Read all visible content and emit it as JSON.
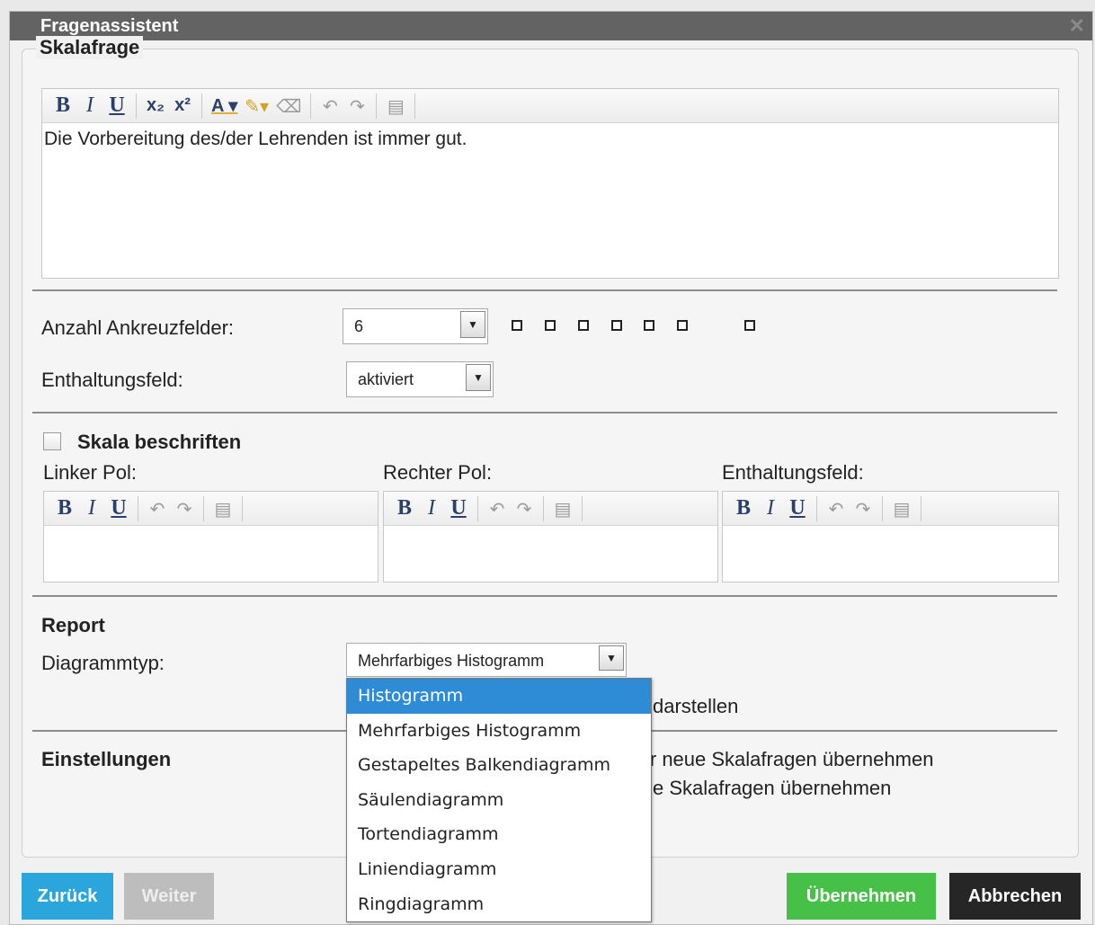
{
  "window": {
    "title": "Fragenassistent",
    "close_icon": "close-icon"
  },
  "question": {
    "legend": "Skalafrage",
    "text": "Die Vorbereitung des/der Lehrenden ist immer gut."
  },
  "toolbar_main": [
    "B",
    "I",
    "U",
    "X₂",
    "X²",
    "A",
    "✎",
    "⚲",
    "⟲",
    "⟳",
    "📋"
  ],
  "fields": {
    "anzahl_label": "Anzahl Ankreuzfelder:",
    "anzahl_value": "6",
    "enthaltung_label": "Enthaltungsfeld:",
    "enthaltung_value": "aktiviert"
  },
  "scale_labels": {
    "checkbox_label": "Skala beschriften",
    "left": "Linker Pol:",
    "right": "Rechter Pol:",
    "abstain": "Enthaltungsfeld:"
  },
  "report": {
    "heading": "Report",
    "diagram_label": "Diagrammtyp:",
    "diagram_value": "Mehrfarbiges Histogramm",
    "options": [
      "Histogramm",
      "Mehrfarbiges Histogramm",
      "Gestapeltes Balkendiagramm",
      "Säulendiagramm",
      "Tortendiagramm",
      "Liniendiagramm",
      "Ringdiagramm"
    ],
    "highlighted_option": "Histogramm",
    "partial_behind": "darstellen"
  },
  "settings": {
    "heading": "Einstellungen",
    "line1_partial": "ir neue Skalafragen übernehmen",
    "line2_partial": "e Skalafragen übernehmen"
  },
  "buttons": {
    "back": "Zurück",
    "next": "Weiter",
    "apply": "Übernehmen",
    "cancel": "Abbrechen"
  },
  "colors": {
    "titlebar": "#636363",
    "back": "#2aa6dc",
    "next": "#bdbdbd",
    "apply": "#46c046",
    "cancel": "#262626",
    "highlight": "#2e8bd6"
  }
}
